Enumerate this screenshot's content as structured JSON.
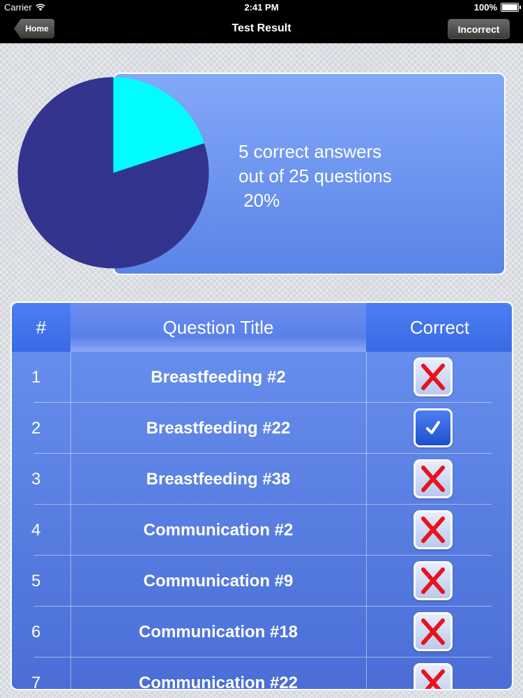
{
  "status_bar": {
    "carrier": "Carrier",
    "time": "2:41 PM",
    "battery": "100%"
  },
  "nav": {
    "back_label": "Home",
    "title": "Test Result",
    "right_label": "Incorrect"
  },
  "summary": {
    "line1": "5 correct answers",
    "line2": "out of 25 questions",
    "line3": " 20%",
    "fraction_correct": 0.2,
    "colors": {
      "correct": "#00fdfd",
      "incorrect": "#33348e"
    }
  },
  "table": {
    "headers": {
      "number": "#",
      "title": "Question Title",
      "correct": "Correct"
    },
    "rows": [
      {
        "num": "1",
        "title": "Breastfeeding #2",
        "correct": false
      },
      {
        "num": "2",
        "title": "Breastfeeding #22",
        "correct": true
      },
      {
        "num": "3",
        "title": "Breastfeeding #38",
        "correct": false
      },
      {
        "num": "4",
        "title": "Communication #2",
        "correct": false
      },
      {
        "num": "5",
        "title": "Communication #9",
        "correct": false
      },
      {
        "num": "6",
        "title": "Communication #18",
        "correct": false
      },
      {
        "num": "7",
        "title": "Communication #22",
        "correct": false
      }
    ]
  }
}
